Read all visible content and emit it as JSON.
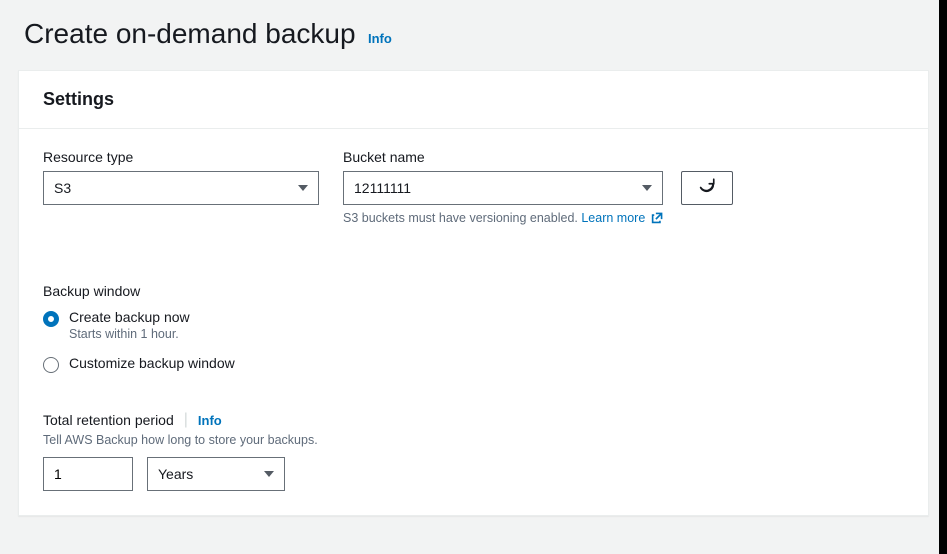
{
  "header": {
    "title": "Create on-demand backup",
    "info_label": "Info"
  },
  "settings": {
    "panel_title": "Settings",
    "resource_type": {
      "label": "Resource type",
      "value": "S3"
    },
    "bucket_name": {
      "label": "Bucket name",
      "value": "12111111",
      "helper_prefix": "S3 buckets must have versioning enabled. ",
      "learn_more": "Learn more"
    },
    "backup_window": {
      "label": "Backup window",
      "options": [
        {
          "label": "Create backup now",
          "desc": "Starts within 1 hour.",
          "selected": true
        },
        {
          "label": "Customize backup window",
          "desc": "",
          "selected": false
        }
      ]
    },
    "retention": {
      "label": "Total retention period",
      "info_label": "Info",
      "desc": "Tell AWS Backup how long to store your backups.",
      "value": "1",
      "unit": "Years"
    }
  }
}
